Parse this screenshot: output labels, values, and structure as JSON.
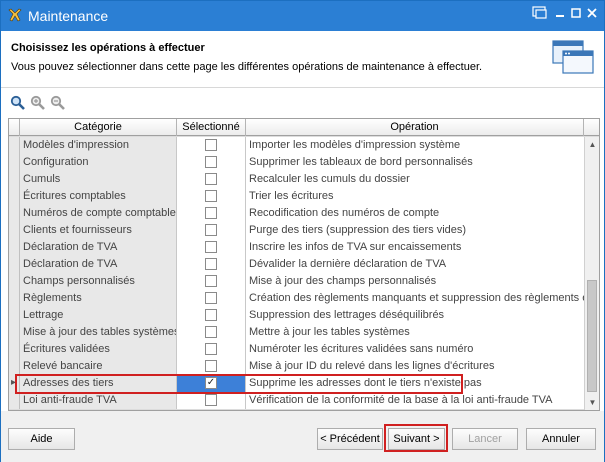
{
  "window": {
    "title": "Maintenance",
    "controls": [
      "restore-icon",
      "minimize-icon",
      "maximize-icon",
      "close-icon"
    ]
  },
  "header": {
    "title": "Choisissez les opérations à effectuer",
    "subtitle": "Vous pouvez sélectionner dans cette page les différentes opérations de maintenance à effectuer."
  },
  "toolbar": {
    "tools": [
      "search-icon",
      "zoom-in-icon",
      "zoom-out-icon"
    ]
  },
  "grid": {
    "columns": [
      "Catégorie",
      "Sélectionné",
      "Opération"
    ],
    "rows": [
      {
        "category": "Modèles d'impression",
        "selected": false,
        "operation": "Importer les modèles d'impression système"
      },
      {
        "category": "Configuration",
        "selected": false,
        "operation": "Supprimer les tableaux de bord personnalisés"
      },
      {
        "category": "Cumuls",
        "selected": false,
        "operation": "Recalculer les cumuls du dossier"
      },
      {
        "category": "Écritures comptables",
        "selected": false,
        "operation": "Trier les écritures"
      },
      {
        "category": "Numéros de compte comptable",
        "selected": false,
        "operation": "Recodification des numéros de compte"
      },
      {
        "category": "Clients et fournisseurs",
        "selected": false,
        "operation": "Purge des tiers (suppression des tiers vides)"
      },
      {
        "category": "Déclaration de TVA",
        "selected": false,
        "operation": "Inscrire les infos de TVA sur encaissements"
      },
      {
        "category": "Déclaration de TVA",
        "selected": false,
        "operation": "Dévalider la dernière déclaration de TVA"
      },
      {
        "category": "Champs personnalisés",
        "selected": false,
        "operation": "Mise à jour des champs personnalisés"
      },
      {
        "category": "Règlements",
        "selected": false,
        "operation": "Création des règlements manquants et suppression des règlements erronés"
      },
      {
        "category": "Lettrage",
        "selected": false,
        "operation": "Suppression des lettrages déséquilibrés"
      },
      {
        "category": "Mise à jour des tables systèmes",
        "selected": false,
        "operation": "Mettre à jour les tables systèmes"
      },
      {
        "category": "Écritures validées",
        "selected": false,
        "operation": "Numéroter les écritures validées sans numéro"
      },
      {
        "category": "Relevé bancaire",
        "selected": false,
        "operation": "Mise à jour ID du relevé dans les lignes d'écritures"
      },
      {
        "category": "Adresses des tiers",
        "selected": true,
        "operation": "Supprime les adresses dont le tiers n'existe pas"
      },
      {
        "category": "Loi anti-fraude TVA",
        "selected": false,
        "operation": "Vérification de la conformité de la base à la loi anti-fraude TVA"
      }
    ]
  },
  "footer": {
    "help": "Aide",
    "previous": "< Précédent",
    "next": "Suivant >",
    "launch": "Lancer",
    "cancel": "Annuler"
  },
  "colors": {
    "titlebar": "#2b7fd4",
    "selection": "#3d80d8",
    "highlight": "#d02020"
  }
}
